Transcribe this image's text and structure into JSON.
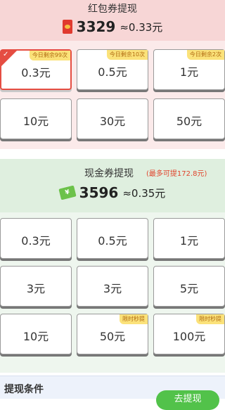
{
  "red_section": {
    "title": "红包券提现",
    "balance": "3329",
    "approx": "≈0.33元",
    "options": [
      {
        "amount": "0.3元",
        "tag": "今日剩余99次",
        "selected": true
      },
      {
        "amount": "0.5元",
        "tag": "今日剩余10次"
      },
      {
        "amount": "1元",
        "tag": "今日剩余2次"
      },
      {
        "amount": "10元"
      },
      {
        "amount": "30元"
      },
      {
        "amount": "50元"
      }
    ]
  },
  "cash_section": {
    "title": "现金券提现",
    "limit": "(最多可提172.8元)",
    "balance": "3596",
    "approx": "≈0.35元",
    "options": [
      {
        "amount": "0.3元"
      },
      {
        "amount": "0.5元"
      },
      {
        "amount": "1元"
      },
      {
        "amount": "3元"
      },
      {
        "amount": "3元"
      },
      {
        "amount": "5元"
      },
      {
        "amount": "10元"
      },
      {
        "amount": "50元",
        "tag": "限时秒提"
      },
      {
        "amount": "100元",
        "tag": "限时秒提"
      }
    ]
  },
  "conditions": {
    "title": "提现条件",
    "button_label": "去提现"
  },
  "colors": {
    "red_header_bg": "#f7d6d6",
    "red_accent": "#e54d42",
    "cash_header_bg": "#dfefdf",
    "tag_bg": "#fbe27a",
    "green_button": "#52c24a"
  },
  "icons": {
    "red_packet": "red-packet-icon",
    "cash": "cash-icon",
    "check": "check-icon"
  }
}
